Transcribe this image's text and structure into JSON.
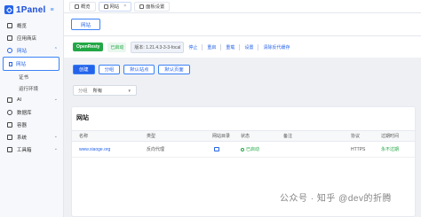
{
  "brand": {
    "name": "1Panel"
  },
  "sidebar": {
    "items": [
      {
        "label": "概览"
      },
      {
        "label": "应用商店"
      },
      {
        "label": "网站"
      },
      {
        "label": "网站"
      },
      {
        "label": "证书"
      },
      {
        "label": "运行环境"
      },
      {
        "label": "AI"
      },
      {
        "label": "数据库"
      },
      {
        "label": "容器"
      },
      {
        "label": "系统"
      },
      {
        "label": "工具箱"
      }
    ]
  },
  "top_tabs": [
    {
      "label": "概览"
    },
    {
      "label": "网站"
    },
    {
      "label": "面板设置"
    }
  ],
  "sub_tabs": [
    {
      "label": "网站"
    }
  ],
  "status": {
    "app": "OpenResty",
    "state": "已启动",
    "version": "版本: 1.21.4.3-3-3-focal",
    "links": [
      "停止",
      "重启",
      "重载",
      "设置",
      "清除反代缓存"
    ]
  },
  "actions": [
    {
      "label": "创建"
    },
    {
      "label": "分组"
    },
    {
      "label": "默认站点"
    },
    {
      "label": "默认页面"
    }
  ],
  "filter": {
    "label": "分组",
    "value": "所有"
  },
  "table": {
    "title": "网站",
    "columns": [
      "名称",
      "类型",
      "网站目录",
      "状态",
      "备注",
      "协议",
      "过期时间"
    ],
    "rows": [
      {
        "name": "www.xiaoge.org",
        "type": "反向代理",
        "status": "已启动",
        "note": "",
        "protocol": "HTTPS",
        "expiry": "永不过期"
      }
    ]
  },
  "watermark": "公众号 · 知乎 @dev的折腾"
}
